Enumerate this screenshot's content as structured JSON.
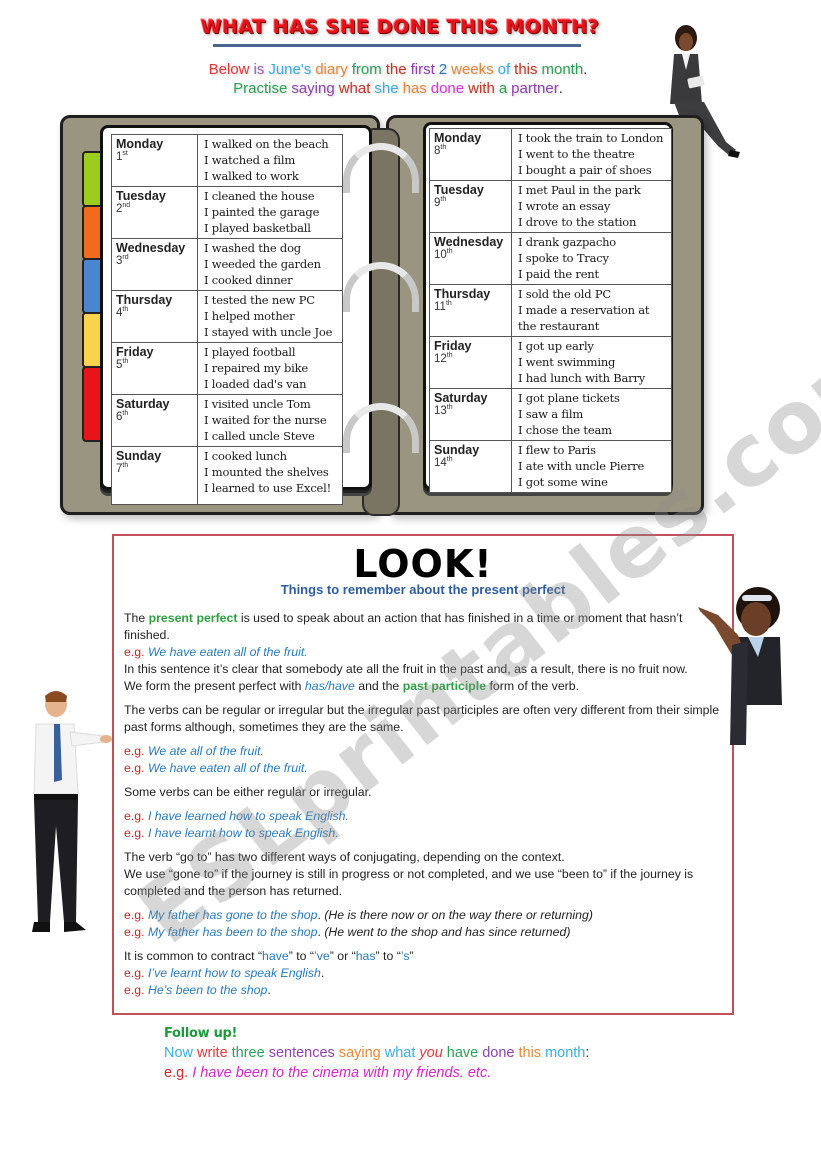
{
  "header": {
    "title": "WHAT HAS SHE DONE THIS MONTH?",
    "intro_line1": [
      {
        "text": "Below",
        "color": "#e03a3a"
      },
      {
        "text": "is",
        "color": "#9b59b6"
      },
      {
        "text": "June's",
        "color": "#3aaee0"
      },
      {
        "text": "diary",
        "color": "#e6883a"
      },
      {
        "text": "from",
        "color": "#2ea05a"
      },
      {
        "text": "the",
        "color": "#c0392b"
      },
      {
        "text": "first",
        "color": "#8e44ad"
      },
      {
        "text": "2",
        "color": "#2a7ab9"
      },
      {
        "text": "weeks",
        "color": "#e08a3a"
      },
      {
        "text": "of",
        "color": "#3aaee0"
      },
      {
        "text": "this",
        "color": "#c0392b"
      },
      {
        "text": "month",
        "color": "#2ea05a"
      },
      {
        "text": ".",
        "color": "#333333"
      }
    ],
    "intro_line2": [
      {
        "text": "Practise",
        "color": "#2ea05a"
      },
      {
        "text": "saying",
        "color": "#8e44ad"
      },
      {
        "text": "what",
        "color": "#c0392b"
      },
      {
        "text": "she",
        "color": "#3aaee0"
      },
      {
        "text": "has",
        "color": "#e6883a"
      },
      {
        "text": "done",
        "color": "#d63ad6"
      },
      {
        "text": "with",
        "color": "#c0392b"
      },
      {
        "text": "a",
        "color": "#2ea05a"
      },
      {
        "text": "partner",
        "color": "#8e44ad"
      },
      {
        "text": ".",
        "color": "#333333"
      }
    ]
  },
  "diary": {
    "tab_colors": [
      "#9acd1e",
      "#f26a1b",
      "#4a86d0",
      "#f8d44c",
      "#e8141a"
    ],
    "week1": [
      {
        "day": "Monday",
        "num": "1",
        "suffix": "st",
        "activities": [
          "I walked on the beach",
          "I watched a film",
          "I walked to work"
        ]
      },
      {
        "day": "Tuesday",
        "num": "2",
        "suffix": "nd",
        "activities": [
          "I cleaned the house",
          "I painted the garage",
          "I played basketball"
        ]
      },
      {
        "day": "Wednesday",
        "num": "3",
        "suffix": "rd",
        "activities": [
          "I washed the dog",
          "I weeded the garden",
          "I cooked dinner"
        ]
      },
      {
        "day": "Thursday",
        "num": "4",
        "suffix": "th",
        "activities": [
          "I tested the new PC",
          "I helped mother",
          "I stayed with uncle Joe"
        ]
      },
      {
        "day": "Friday",
        "num": "5",
        "suffix": "th",
        "activities": [
          "I played football",
          "I repaired my bike",
          "I loaded dad's van"
        ]
      },
      {
        "day": "Saturday",
        "num": "6",
        "suffix": "th",
        "activities": [
          "I visited uncle Tom",
          "I waited for the nurse",
          "I called uncle Steve"
        ]
      },
      {
        "day": "Sunday",
        "num": "7",
        "suffix": "th",
        "activities": [
          "I cooked lunch",
          "I mounted the shelves",
          "I learned to use Excel!"
        ]
      }
    ],
    "week2": [
      {
        "day": "Monday",
        "num": "8",
        "suffix": "th",
        "activities": [
          "I took the train to London",
          "I went to the theatre",
          "I bought a pair of shoes"
        ]
      },
      {
        "day": "Tuesday",
        "num": "9",
        "suffix": "th",
        "activities": [
          "I met Paul in the park",
          "I wrote an essay",
          "I drove to the station"
        ]
      },
      {
        "day": "Wednesday",
        "num": "10",
        "suffix": "th",
        "activities": [
          "I drank gazpacho",
          "I spoke to Tracy",
          "I paid the rent"
        ]
      },
      {
        "day": "Thursday",
        "num": "11",
        "suffix": "th",
        "activities": [
          "I sold the old PC",
          "I made a reservation at",
          "the restaurant"
        ]
      },
      {
        "day": "Friday",
        "num": "12",
        "suffix": "th",
        "activities": [
          "I got up early",
          "I went swimming",
          "I had lunch with Barry"
        ]
      },
      {
        "day": "Saturday",
        "num": "13",
        "suffix": "th",
        "activities": [
          "I got plane tickets",
          "I saw a film",
          "I chose the team"
        ]
      },
      {
        "day": "Sunday",
        "num": "14",
        "suffix": "th",
        "activities": [
          "I flew to Paris",
          "I ate with uncle Pierre",
          "I got some wine"
        ]
      }
    ]
  },
  "look": {
    "title": "LOOK!",
    "subtitle": "Things to remember about the present perfect",
    "p1": {
      "a": "The ",
      "b": "present perfect",
      "c": " is used to speak about an action that has finished in a time or moment that hasn’t finished.",
      "eg": "e.g.",
      "ex": "We have eaten all of the fruit.",
      "d": "In this sentence it’s clear that somebody ate all the fruit in the past and, as a result, there is no fruit now.",
      "e": "We form the present perfect with ",
      "f": "has/have",
      "g": " and the ",
      "h": "past participle",
      "i": " form of the verb."
    },
    "p2": {
      "text": "The verbs can be regular or irregular but the irregular past participles are often very different from their simple past forms although, sometimes they are the same.",
      "eg": "e.g.",
      "ex1": "We ate all of the fruit.",
      "ex2": "We have eaten all of the fruit."
    },
    "p3": {
      "text": "Some verbs can be either regular or irregular.",
      "eg": "e.g.",
      "ex1": "I have learned how to speak English.",
      "ex2": "I have learnt how to speak English."
    },
    "p4": {
      "line1": "The verb “go to” has two different ways of conjugating, depending on the context.",
      "line2": "We use “gone to” if the journey is still in progress or not completed, and we use “been to” if the journey is completed and the person has returned.",
      "eg": "e.g.",
      "ex1": "My father has gone to the shop",
      "note1": "(He is there now or on the way there or returning)",
      "ex2": "My father has been to the shop",
      "note2": "(He went to the shop and has since returned)"
    },
    "p5": {
      "a": "It is common to contract “",
      "b": "have",
      "c": "” to “",
      "d": "’ve",
      "e": "” or “",
      "f": "has",
      "g": "” to “",
      "h": "’s",
      "i": "”",
      "eg": "e.g.",
      "ex1": "I’ve learnt how to speak English",
      "ex2": "He’s been to the shop"
    }
  },
  "follow_up": {
    "title": "Follow up!",
    "line": [
      {
        "text": "Now",
        "color": "#3aaee0",
        "italic": false
      },
      {
        "text": "write",
        "color": "#e03a3a",
        "italic": false
      },
      {
        "text": "three",
        "color": "#2ea05a",
        "italic": false
      },
      {
        "text": "sentences",
        "color": "#8e44ad",
        "italic": false
      },
      {
        "text": "saying",
        "color": "#e6883a",
        "italic": false
      },
      {
        "text": "what",
        "color": "#3aaee0",
        "italic": false
      },
      {
        "text": "you",
        "color": "#e03a3a",
        "italic": true
      },
      {
        "text": "have",
        "color": "#2ea05a",
        "italic": false
      },
      {
        "text": "done",
        "color": "#8e44ad",
        "italic": false
      },
      {
        "text": "this",
        "color": "#e6883a",
        "italic": false
      },
      {
        "text": "month",
        "color": "#3aaee0",
        "italic": false
      },
      {
        "text": ":",
        "color": "#333333",
        "italic": false
      }
    ],
    "eg": "e.g.",
    "example": "I have been to the cinema with my friends. etc."
  },
  "watermark": "ESLprintables.com"
}
